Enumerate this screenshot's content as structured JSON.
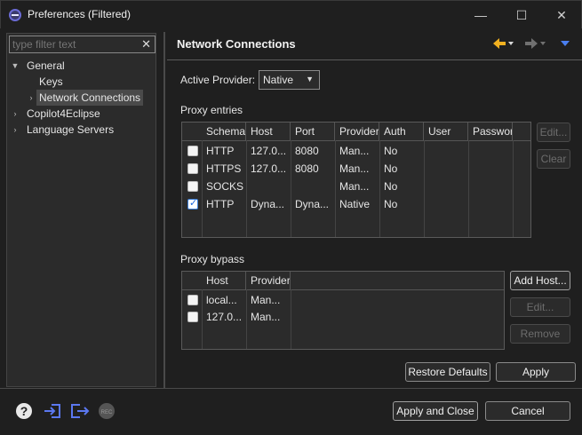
{
  "window": {
    "title": "Preferences (Filtered)",
    "minimize_glyph": "—",
    "maximize_glyph": "☐",
    "close_glyph": "✕"
  },
  "left": {
    "filter_placeholder": "type filter text",
    "filter_clear_glyph": "✕",
    "tree": [
      {
        "label": "General",
        "twisty": "expanded"
      },
      {
        "label": "Keys",
        "twisty": "none"
      },
      {
        "label": "Network Connections",
        "twisty": "collapsed",
        "selected": true
      },
      {
        "label": "Copilot4Eclipse",
        "twisty": "collapsed"
      },
      {
        "label": "Language Servers",
        "twisty": "collapsed"
      }
    ]
  },
  "header": {
    "title": "Network Connections",
    "back_icon": "arrow-left-icon",
    "forward_icon": "arrow-right-icon",
    "menu_icon": "view-menu-icon",
    "accent_color": "#f0b020",
    "menu_color": "#4a7ff0"
  },
  "provider": {
    "label": "Active Provider:",
    "value": "Native"
  },
  "proxy_entries": {
    "label": "Proxy entries",
    "columns": [
      "Schema",
      "Host",
      "Port",
      "Provider",
      "Auth",
      "User",
      "Password"
    ],
    "rows": [
      {
        "checked": false,
        "cells": [
          "HTTP",
          "127.0...",
          "8080",
          "Man...",
          "No",
          "",
          ""
        ]
      },
      {
        "checked": false,
        "cells": [
          "HTTPS",
          "127.0...",
          "8080",
          "Man...",
          "No",
          "",
          ""
        ]
      },
      {
        "checked": false,
        "cells": [
          "SOCKS",
          "",
          "",
          "Man...",
          "No",
          "",
          ""
        ]
      },
      {
        "checked": true,
        "cells": [
          "HTTP",
          "Dyna...",
          "Dyna...",
          "Native",
          "No",
          "",
          ""
        ]
      }
    ],
    "edit_label": "Edit...",
    "clear_label": "Clear"
  },
  "proxy_bypass": {
    "label": "Proxy bypass",
    "columns": [
      "Host",
      "Provider"
    ],
    "rows": [
      {
        "checked": false,
        "cells": [
          "local...",
          "Man..."
        ]
      },
      {
        "checked": false,
        "cells": [
          "127.0...",
          "Man..."
        ]
      }
    ],
    "add_host_label": "Add Host...",
    "edit_label": "Edit...",
    "remove_label": "Remove"
  },
  "actions": {
    "restore_label": "Restore Defaults",
    "apply_label": "Apply",
    "apply_close_label": "Apply and Close",
    "cancel_label": "Cancel"
  },
  "footer": {
    "help_icon": "help-icon",
    "import_icon": "import-icon",
    "export_icon": "export-icon",
    "record_icon": "record-icon",
    "record_label": "REC"
  }
}
